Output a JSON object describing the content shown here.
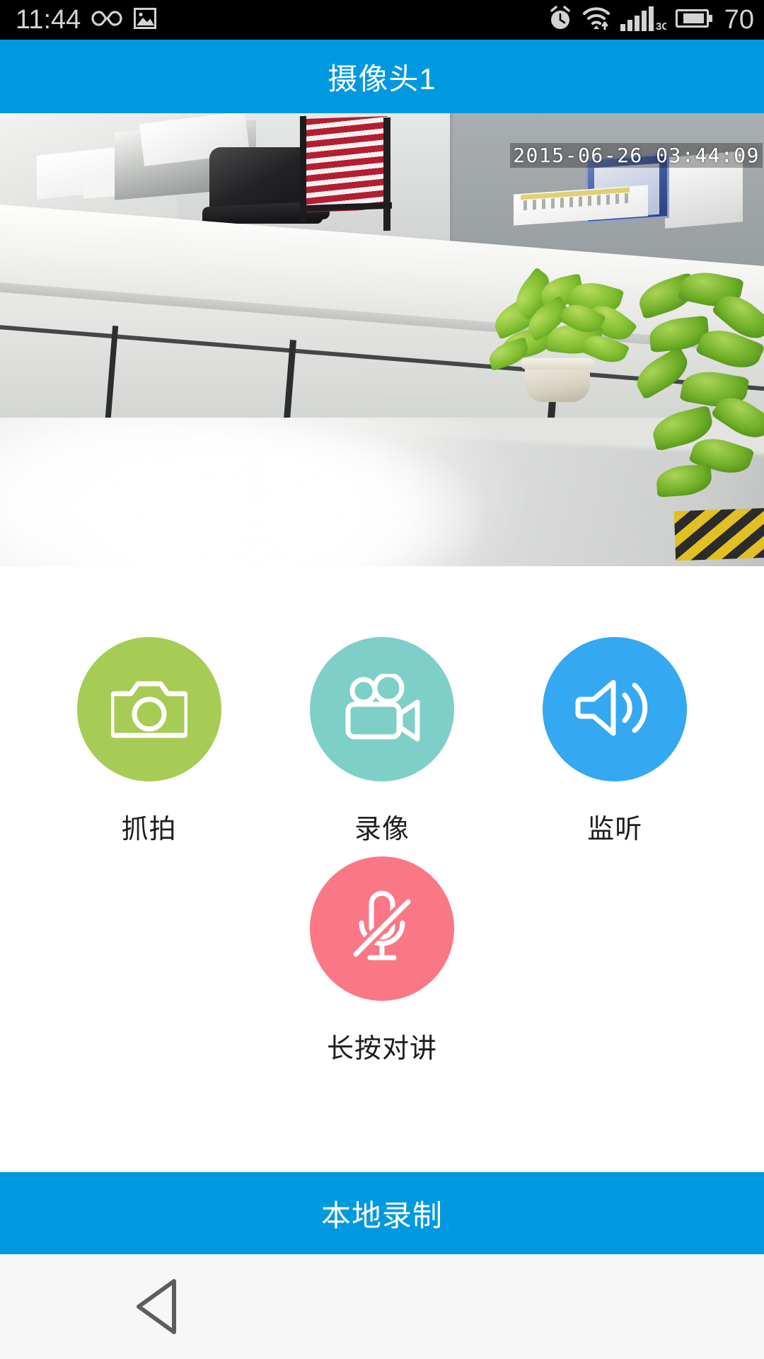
{
  "status_bar": {
    "time": "11:44",
    "battery_level": "70",
    "icons": [
      {
        "name": "infinity-icon",
        "label": "infinity"
      },
      {
        "name": "image-icon",
        "label": "image"
      },
      {
        "name": "alarm-clock-icon",
        "label": "alarm"
      },
      {
        "name": "wifi-icon",
        "label": "wifi"
      },
      {
        "name": "signal-bars-icon",
        "label": "signal"
      },
      {
        "name": "battery-icon",
        "label": "battery"
      }
    ],
    "network_type": "3G",
    "background_color": "#000000",
    "text_color": "#d2d2d2"
  },
  "title_bar": {
    "title": "摄像头1",
    "background_color": "#0099e0",
    "text_color": "#ffffff"
  },
  "video": {
    "timestamp": "2015-06-26 03:44:09",
    "scene_description": "office reception counter with chairs and potted plant"
  },
  "controls": {
    "top_row": [
      {
        "id": "snapshot",
        "label": "抓拍",
        "icon": "camera-icon",
        "color": "#a6cc55"
      },
      {
        "id": "record",
        "label": "录像",
        "icon": "video-camera-icon",
        "color": "#7ecfc8"
      },
      {
        "id": "listen",
        "label": "监听",
        "icon": "speaker-icon",
        "color": "#34a8f0"
      }
    ],
    "bottom_row": [
      {
        "id": "talk",
        "label": "长按对讲",
        "icon": "microphone-muted-icon",
        "color": "#fa7886"
      }
    ]
  },
  "local_record": {
    "label": "本地录制",
    "background_color": "#0099e0"
  },
  "nav_bar": {
    "back_icon": "back-triangle-icon",
    "background_color": "#f7f7f7"
  }
}
